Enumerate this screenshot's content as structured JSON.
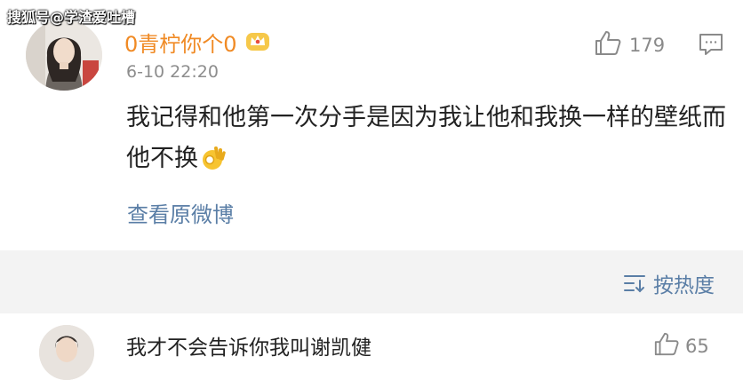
{
  "watermark": "搜狐号@学渣爱吐槽",
  "comment": {
    "username": "0青柠你个0",
    "timestamp": "6-10 22:20",
    "text": "我记得和他第一次分手是因为我让他和我换一样的壁纸而他不换",
    "emoji": "ok-hand-icon",
    "likes": "179",
    "view_original": "查看原微博"
  },
  "sort": {
    "label": "按热度"
  },
  "reply": {
    "text": "我才不会告诉你我叫谢凯健",
    "likes": "65"
  },
  "colors": {
    "username": "#f08a24",
    "link": "#5a7ea6",
    "band": "#f3f3f3",
    "text": "#222222",
    "muted": "#8a8a8a"
  }
}
